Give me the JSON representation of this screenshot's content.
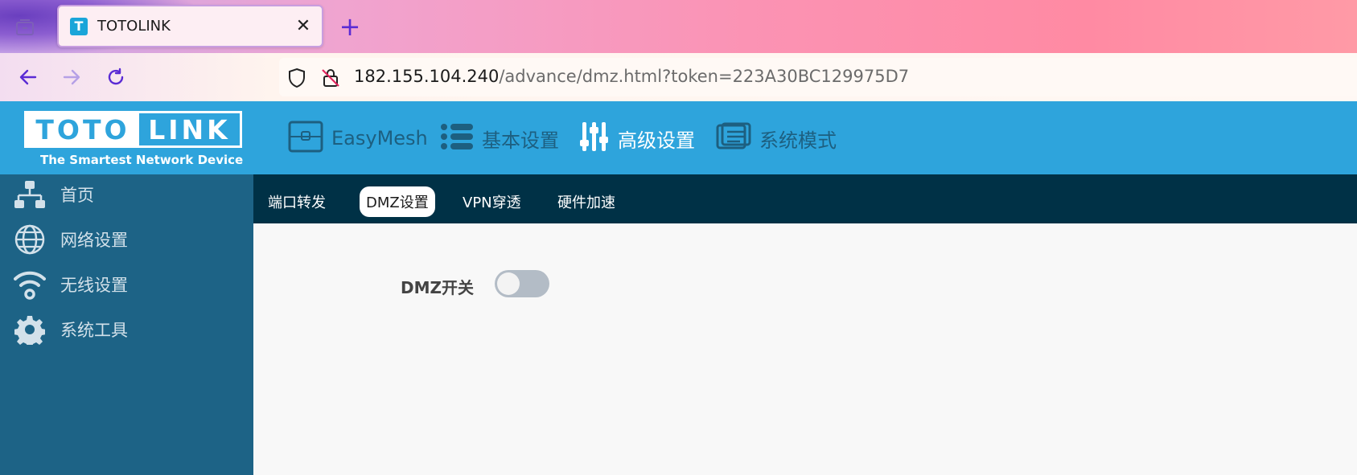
{
  "browser": {
    "tab": {
      "title": "TOTOLINK",
      "favicon_letter": "T"
    },
    "new_tab_label": "+",
    "address": {
      "host": "182.155.104.240",
      "path": "/advance/dmz.html?token=223A30BC129975D7"
    },
    "icons": {
      "overview": "tab-overview-icon",
      "back": "back-arrow-icon",
      "forward": "forward-arrow-icon",
      "reload": "reload-icon",
      "shield": "shield-icon",
      "insecure_lock": "insecure-lock-icon",
      "close": "close-icon"
    }
  },
  "header": {
    "logo": {
      "left": "TOTO",
      "right": "LINK",
      "tagline": "The Smartest Network Device"
    },
    "nav": [
      {
        "label": "EasyMesh",
        "icon": "easymesh-icon",
        "active": false
      },
      {
        "label": "基本设置",
        "icon": "list-icon",
        "active": false
      },
      {
        "label": "高级设置",
        "icon": "sliders-icon",
        "active": true
      },
      {
        "label": "系统模式",
        "icon": "system-mode-icon",
        "active": false
      }
    ]
  },
  "sidebar": {
    "items": [
      {
        "label": "首页",
        "icon": "network-topology-icon"
      },
      {
        "label": "网络设置",
        "icon": "globe-icon"
      },
      {
        "label": "无线设置",
        "icon": "wifi-icon"
      },
      {
        "label": "系统工具",
        "icon": "gear-icon"
      }
    ]
  },
  "subnav": {
    "tabs": [
      {
        "label": "端口转发",
        "active": false
      },
      {
        "label": "DMZ设置",
        "active": true
      },
      {
        "label": "VPN穿透",
        "active": false
      },
      {
        "label": "硬件加速",
        "active": false
      }
    ]
  },
  "dmz": {
    "switch_label": "DMZ开关",
    "enabled": false
  },
  "colors": {
    "header_bg": "#2ea4dc",
    "sidebar_bg": "#1d6386",
    "subnav_bg": "#003146",
    "content_bg": "#f8f8f8",
    "toggle_off": "#b3bcc6"
  }
}
